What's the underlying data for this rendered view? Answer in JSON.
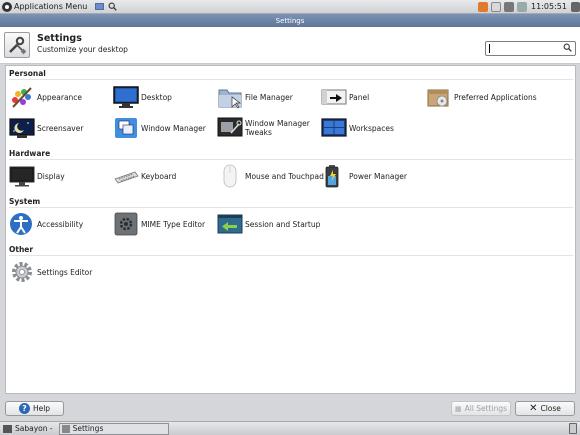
{
  "top_panel": {
    "menu_label": "Applications Menu",
    "clock": "11:05:51"
  },
  "window": {
    "title": "Settings"
  },
  "header": {
    "title": "Settings",
    "subtitle": "Customize your desktop",
    "search_value": ""
  },
  "categories": {
    "personal": "Personal",
    "hardware": "Hardware",
    "system": "System",
    "other": "Other"
  },
  "items": {
    "appearance": "Appearance",
    "desktop": "Desktop",
    "file_manager": "File Manager",
    "panel": "Panel",
    "preferred_applications": "Preferred Applications",
    "screensaver": "Screensaver",
    "window_manager": "Window Manager",
    "window_manager_tweaks": "Window Manager\nTweaks",
    "workspaces": "Workspaces",
    "display": "Display",
    "keyboard": "Keyboard",
    "mouse_and_touchpad": "Mouse and Touchpad",
    "power_manager": "Power Manager",
    "accessibility": "Accessibility",
    "mime_type_editor": "MIME Type Editor",
    "session_and_startup": "Session and Startup",
    "settings_editor": "Settings Editor"
  },
  "buttons": {
    "help": "Help",
    "all_settings": "All Settings",
    "close": "Close"
  },
  "taskbar": {
    "start_label": "Sabayon -",
    "task_label": "Settings"
  },
  "colors": {
    "titlebar": "#6b82a6",
    "content_bg": "#ffffff",
    "help_blue": "#2e67b8"
  }
}
